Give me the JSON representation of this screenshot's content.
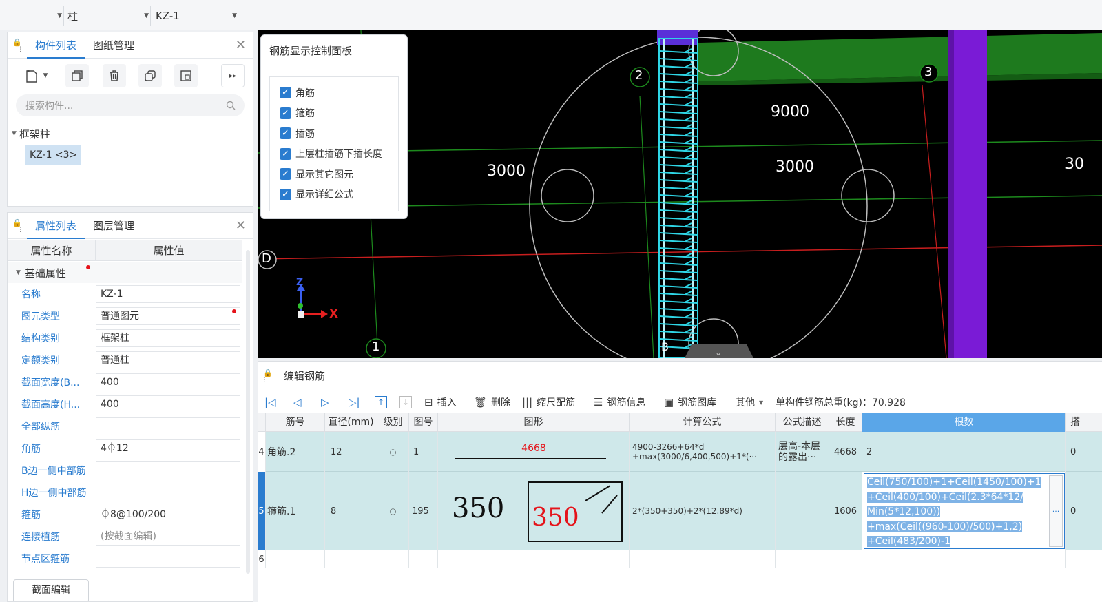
{
  "topbar": {
    "combo1": "",
    "combo2": "柱",
    "combo3": "KZ-1"
  },
  "component_panel": {
    "tabs": [
      "构件列表",
      "图纸管理"
    ],
    "search_placeholder": "搜索构件...",
    "tree_group": "框架柱",
    "tree_item": "KZ-1 <3>"
  },
  "property_panel": {
    "tabs": [
      "属性列表",
      "图层管理"
    ],
    "col_name": "属性名称",
    "col_value": "属性值",
    "group": "基础属性",
    "rows": [
      {
        "name": "名称",
        "value": "KZ-1"
      },
      {
        "name": "图元类型",
        "value": "普通图元"
      },
      {
        "name": "结构类别",
        "value": "框架柱"
      },
      {
        "name": "定额类别",
        "value": "普通柱"
      },
      {
        "name": "截面宽度(B...",
        "value": "400"
      },
      {
        "name": "截面高度(H...",
        "value": "400"
      },
      {
        "name": "全部纵筋",
        "value": ""
      },
      {
        "name": "角筋",
        "value": "4⏀12"
      },
      {
        "name": "B边一侧中部筋",
        "value": ""
      },
      {
        "name": "H边一侧中部筋",
        "value": ""
      },
      {
        "name": "箍筋",
        "value": "⏀8@100/200"
      },
      {
        "name": "连接植筋",
        "value": "(按截面编辑)"
      },
      {
        "name": "节点区箍筋",
        "value": ""
      }
    ],
    "section_edit_button": "截面编辑"
  },
  "rebar_control": {
    "title": "钢筋显示控制面板",
    "options": [
      "角筋",
      "箍筋",
      "插筋",
      "上层柱插筋下插长度",
      "显示其它图元",
      "显示详细公式"
    ]
  },
  "viewport": {
    "dim_top": "9000",
    "dim_left": "3000",
    "dim_right": "3000",
    "dim_far": "30",
    "axis_2": "2",
    "axis_3": "3",
    "axis_1": "1",
    "axis_D": "D",
    "axis_z": "Z",
    "axis_x": "X",
    "axis_b": "B"
  },
  "edit_rebar": {
    "title": "编辑钢筋",
    "toolbar": {
      "insert": "插入",
      "delete": "删除",
      "scale": "缩尺配筋",
      "info": "钢筋信息",
      "library": "钢筋图库",
      "other": "其他",
      "total_weight": "单构件钢筋总重(kg)：70.928"
    },
    "headers": [
      "筋号",
      "直径(mm)",
      "级别",
      "图号",
      "图形",
      "计算公式",
      "公式描述",
      "长度",
      "根数",
      "搭"
    ],
    "rows": [
      {
        "num": "4",
        "name": "角筋.2",
        "diameter": "12",
        "grade": "⏀",
        "fig": "1",
        "shape_value": "4668",
        "formula_1": "4900-3266+64*d",
        "formula_2": "+max(3000/6,400,500)+1*(···",
        "desc_1": "层高-本层",
        "desc_2": "的露出···",
        "length": "4668",
        "count": "2",
        "lap": "0"
      },
      {
        "num": "5",
        "name": "箍筋.1",
        "diameter": "8",
        "grade": "⏀",
        "fig": "195",
        "shape_value_a": "350",
        "shape_value_b": "350",
        "formula_1": "2*(350+350)+2*(12.89*d)",
        "length": "1606",
        "count_lines": [
          "Ceil(750/100)+1+Ceil(1450/100)+1",
          "+Ceil(400/100)+Ceil(2.3*64*12/",
          "Min(5*12,100))",
          "+max(Ceil((960-100)/500)+1,2)",
          "+Ceil(483/200)-1"
        ],
        "count_more": "···",
        "lap": "0"
      },
      {
        "num": "6"
      }
    ]
  }
}
